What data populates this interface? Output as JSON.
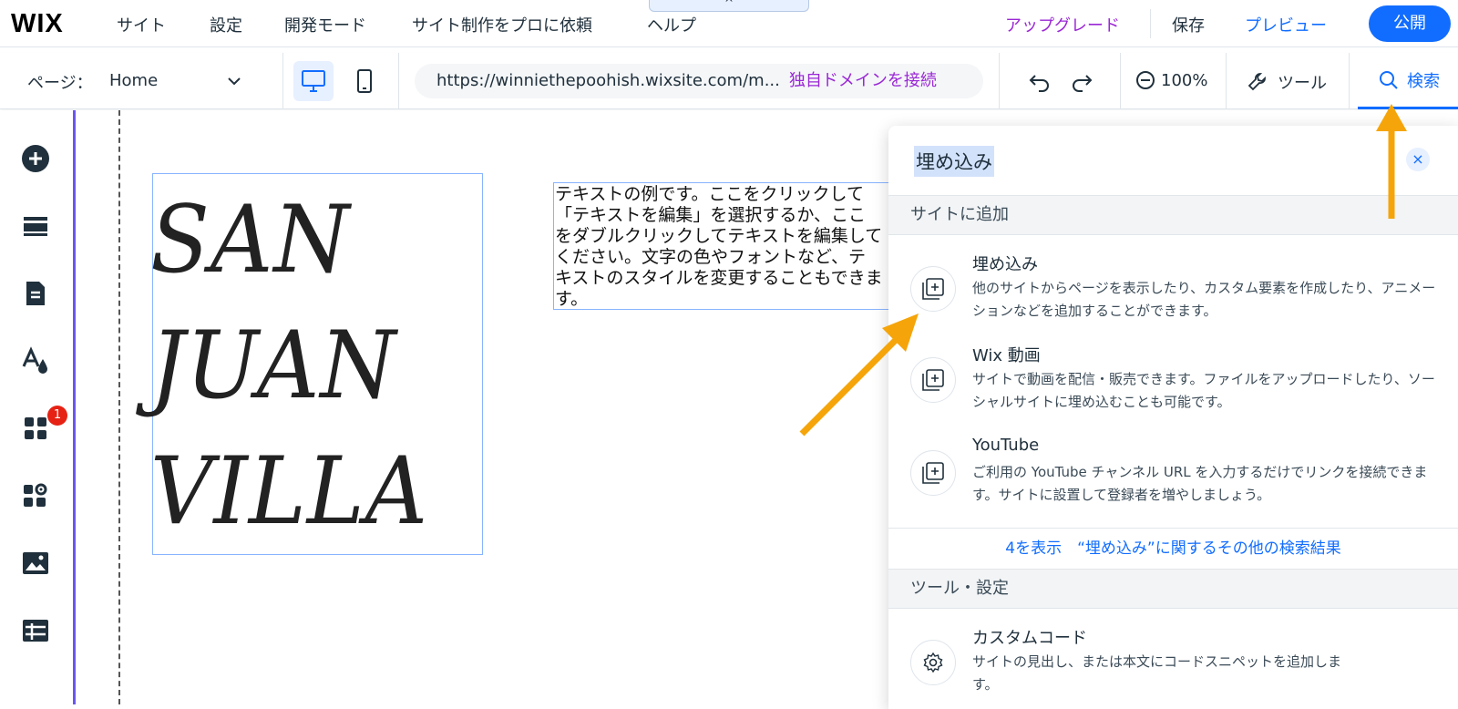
{
  "topbar": {
    "logo": "WIX",
    "menu": [
      "サイト",
      "設定",
      "開発モード",
      "サイト制作をプロに依頼",
      "ヘルプ"
    ],
    "collapse_glyph": "^",
    "upgrade": "アップグレード",
    "save": "保存",
    "preview": "プレビュー",
    "publish": "公開"
  },
  "toolbar": {
    "page_label": "ページ：",
    "page_value": "Home",
    "url": "https://winniethepoohish.wixsite.com/m...",
    "connect_domain": "独自ドメインを接続",
    "zoom": "100%",
    "tools": "ツール",
    "search": "検索"
  },
  "rail": {
    "icons": [
      "add-icon",
      "sections-icon",
      "pages-icon",
      "theme-icon",
      "apps-icon",
      "business-icon",
      "media-icon",
      "cms-icon"
    ],
    "badge_count": "1"
  },
  "canvas": {
    "title_lines": [
      "SAN",
      "JUAN",
      "VILLA"
    ],
    "body_text": "テキストの例です。ここをクリックして「テキストを編集」を選択するか、ここをダブルクリックしてテキストを編集してください。文字の色やフォントなど、テキストのスタイルを変更することもできます。"
  },
  "search_panel": {
    "query": "埋め込み",
    "close_glyph": "×",
    "section_add": "サイトに追加",
    "results": [
      {
        "title": "埋め込み",
        "desc": "他のサイトからページを表示したり、カスタム要素を作成したり、アニメーションなどを追加することができます。"
      },
      {
        "title": "Wix 動画",
        "desc": "サイトで動画を配信・販売できます。ファイルをアップロードしたり、ソーシャルサイトに埋め込むことも可能です。"
      },
      {
        "title": "YouTube",
        "desc": "ご利用の YouTube チャンネル URL を入力するだけでリンクを接続できます。サイトに設置して登録者を増やしましょう。"
      }
    ],
    "more_link": "4を表示　“埋め込み”に関するその他の検索結果",
    "section_tools": "ツール・設定",
    "tool_result": {
      "title": "カスタムコード",
      "desc": "サイトの見出し、または本文にコードスニペットを追加します。"
    }
  },
  "colors": {
    "accent": "#116dff",
    "upgrade": "#9a27d5",
    "annotation_arrow": "#f5a50a",
    "rail_line": "#6b56ee"
  }
}
